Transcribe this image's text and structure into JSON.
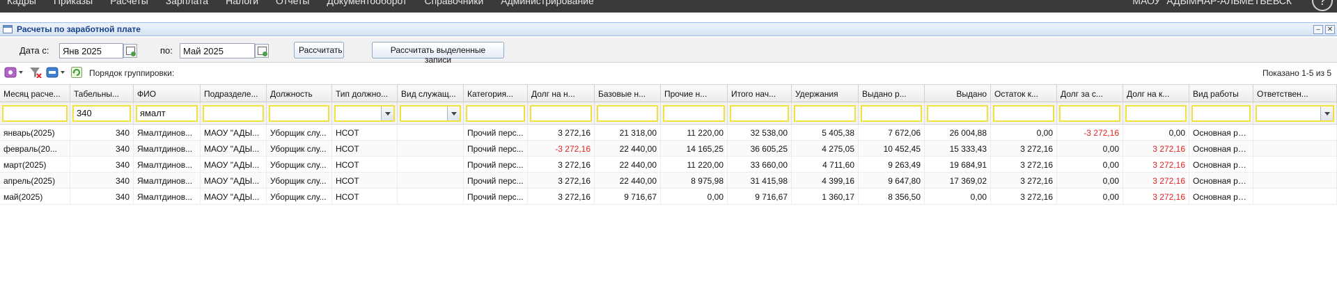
{
  "topbar": {
    "menu": [
      "Кадры",
      "Приказы",
      "Расчеты",
      "Зарплата",
      "Налоги",
      "Отчеты",
      "Документооборот",
      "Справочники",
      "Администрирование"
    ],
    "org": "МАОУ \"АДЫМНАР-АЛЬМЕТЬЕВСК\"",
    "help": "?"
  },
  "panel": {
    "title": "Расчеты по заработной плате",
    "min": "–",
    "close": "✕"
  },
  "filter": {
    "date_from_label": "Дата с:",
    "date_from": "Янв 2025",
    "date_to_label": "по:",
    "date_to": "Май 2025",
    "calc_button": "Рассчитать",
    "calc_selected_button": "Рассчитать выделенные записи"
  },
  "toolbar": {
    "grouping_label": "Порядок группировки:",
    "showing": "Показано 1-5 из 5"
  },
  "columns": [
    "Месяц расче...",
    "Табельны...",
    "ФИО",
    "Подразделе...",
    "Должность",
    "Тип должно...",
    "Вид служащ...",
    "Категория...",
    "Долг на н...",
    "Базовые н...",
    "Прочие н...",
    "Итого нач...",
    "Удержания",
    "Выдано р...",
    "Выдано",
    "Остаток к...",
    "Долг за с...",
    "Долг на к...",
    "Вид работы",
    "Ответствен..."
  ],
  "filters": [
    "",
    "340",
    "ямалт",
    "",
    "",
    "",
    "",
    "",
    "",
    "",
    "",
    "",
    "",
    "",
    "",
    "",
    "",
    "",
    "",
    ""
  ],
  "rows": [
    [
      "январь(2025)",
      "340",
      "Ямалтдинов...",
      "МАОУ \"АДЫ...",
      "Уборщик слу...",
      "НСОТ",
      "",
      "Прочий перс...",
      "3 272,16",
      "21 318,00",
      "11 220,00",
      "32 538,00",
      "5 405,38",
      "7 672,06",
      "26 004,88",
      "0,00",
      "-3 272,16",
      "0,00",
      "Основная ра...",
      ""
    ],
    [
      "февраль(20...",
      "340",
      "Ямалтдинов...",
      "МАОУ \"АДЫ...",
      "Уборщик слу...",
      "НСОТ",
      "",
      "Прочий перс...",
      "-3 272,16",
      "22 440,00",
      "14 165,25",
      "36 605,25",
      "4 275,05",
      "10 452,45",
      "15 333,43",
      "3 272,16",
      "0,00",
      "3 272,16",
      "Основная ра...",
      ""
    ],
    [
      "март(2025)",
      "340",
      "Ямалтдинов...",
      "МАОУ \"АДЫ...",
      "Уборщик слу...",
      "НСОТ",
      "",
      "Прочий перс...",
      "3 272,16",
      "22 440,00",
      "11 220,00",
      "33 660,00",
      "4 711,60",
      "9 263,49",
      "19 684,91",
      "3 272,16",
      "0,00",
      "3 272,16",
      "Основная ра...",
      ""
    ],
    [
      "апрель(2025)",
      "340",
      "Ямалтдинов...",
      "МАОУ \"АДЫ...",
      "Уборщик слу...",
      "НСОТ",
      "",
      "Прочий перс...",
      "3 272,16",
      "22 440,00",
      "8 975,98",
      "31 415,98",
      "4 399,16",
      "9 647,80",
      "17 369,02",
      "3 272,16",
      "0,00",
      "3 272,16",
      "Основная ра...",
      ""
    ],
    [
      "май(2025)",
      "340",
      "Ямалтдинов...",
      "МАОУ \"АДЫ...",
      "Уборщик слу...",
      "НСОТ",
      "",
      "Прочий перс...",
      "3 272,16",
      "9 716,67",
      "0,00",
      "9 716,67",
      "1 360,17",
      "8 356,50",
      "0,00",
      "3 272,16",
      "0,00",
      "3 272,16",
      "Основная ра...",
      ""
    ]
  ],
  "colors": {
    "negative": "#e02020",
    "filter_border": "#f0e23c",
    "header_blue": "#15428b"
  }
}
